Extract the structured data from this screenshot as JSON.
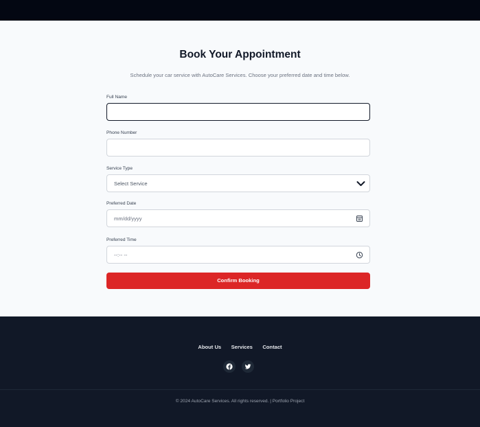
{
  "booking": {
    "title": "Book Your Appointment",
    "subtitle": "Schedule your car service with AutoCare Services. Choose your preferred date and time below.",
    "fields": {
      "full_name": {
        "label": "Full Name",
        "value": ""
      },
      "phone": {
        "label": "Phone Number",
        "value": ""
      },
      "service": {
        "label": "Service Type",
        "selected": "Select Service"
      },
      "date": {
        "label": "Preferred Date",
        "placeholder": "mm/dd/yyyy"
      },
      "time": {
        "label": "Preferred Time",
        "placeholder": "--:-- --"
      }
    },
    "submit_label": "Confirm Booking"
  },
  "footer": {
    "links": [
      "About Us",
      "Services",
      "Contact"
    ],
    "socials": [
      "facebook-icon",
      "twitter-icon"
    ],
    "copyright": "© 2024 AutoCare Services. All rights reserved. | Portfolio Project"
  },
  "colors": {
    "topbar": "#030712",
    "accent": "#dc2626",
    "footer_bg": "#111827",
    "page_bg": "#f8fafc"
  }
}
